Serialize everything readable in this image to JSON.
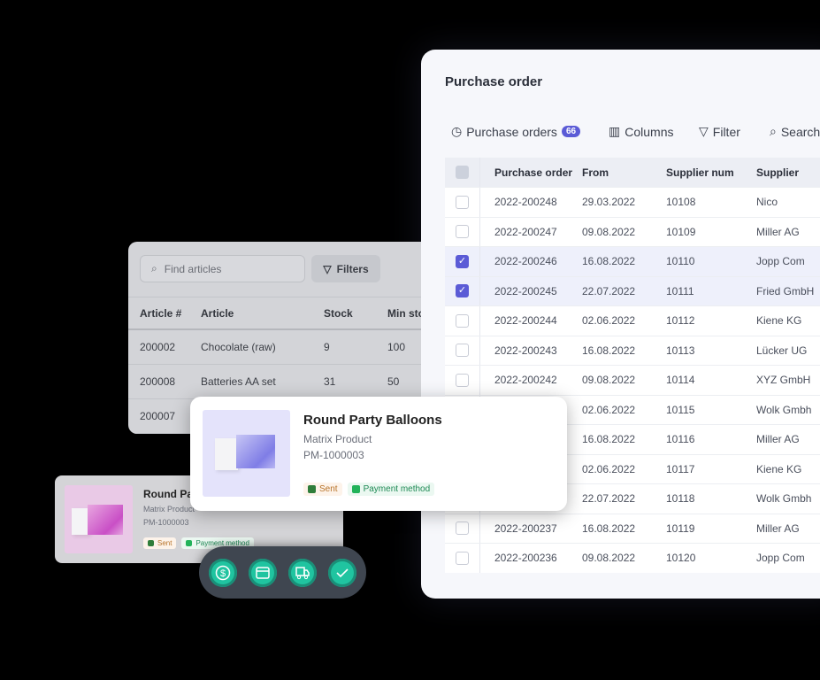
{
  "purchase_order": {
    "title": "Purchase order",
    "toolbar": {
      "orders_label": "Purchase orders",
      "orders_count": "66",
      "columns_label": "Columns",
      "filter_label": "Filter",
      "search_label": "Search"
    },
    "columns": [
      "Purchase order",
      "From",
      "Supplier num",
      "Supplier"
    ],
    "rows": [
      {
        "po": "2022-200248",
        "from": "29.03.2022",
        "num": "10108",
        "supplier": "Nico",
        "checked": false
      },
      {
        "po": "2022-200247",
        "from": "09.08.2022",
        "num": "10109",
        "supplier": "Miller AG",
        "checked": false
      },
      {
        "po": "2022-200246",
        "from": "16.08.2022",
        "num": "10110",
        "supplier": "Jopp Com",
        "checked": true
      },
      {
        "po": "2022-200245",
        "from": "22.07.2022",
        "num": "10111",
        "supplier": "Fried GmbH",
        "checked": true
      },
      {
        "po": "2022-200244",
        "from": "02.06.2022",
        "num": "10112",
        "supplier": "Kiene KG",
        "checked": false
      },
      {
        "po": "2022-200243",
        "from": "16.08.2022",
        "num": "10113",
        "supplier": "Lücker UG",
        "checked": false
      },
      {
        "po": "2022-200242",
        "from": "09.08.2022",
        "num": "10114",
        "supplier": "XYZ GmbH",
        "checked": false
      },
      {
        "po": "",
        "from": "02.06.2022",
        "num": "10115",
        "supplier": "Wolk Gmbh",
        "checked": false
      },
      {
        "po": "",
        "from": "16.08.2022",
        "num": "10116",
        "supplier": "Miller AG",
        "checked": false
      },
      {
        "po": "",
        "from": "02.06.2022",
        "num": "10117",
        "supplier": "Kiene KG",
        "checked": false
      },
      {
        "po": "",
        "from": "22.07.2022",
        "num": "10118",
        "supplier": "Wolk Gmbh",
        "checked": false
      },
      {
        "po": "2022-200237",
        "from": "16.08.2022",
        "num": "10119",
        "supplier": "Miller AG",
        "checked": false
      },
      {
        "po": "2022-200236",
        "from": "09.08.2022",
        "num": "10120",
        "supplier": "Jopp Com",
        "checked": false
      }
    ]
  },
  "articles": {
    "search_placeholder": "Find articles",
    "filters_label": "Filters",
    "columns": [
      "Article #",
      "Article",
      "Stock",
      "Min stock"
    ],
    "rows": [
      [
        "200002",
        "Chocolate (raw)",
        "9",
        "100"
      ],
      [
        "200008",
        "Batteries AA set",
        "31",
        "50"
      ],
      [
        "200007",
        "",
        "",
        ""
      ]
    ]
  },
  "product_card": {
    "title": "Round Party Balloons",
    "type": "Matrix Product",
    "sku": "PM-1000003",
    "tags": [
      "Sent",
      "Payment method"
    ]
  },
  "back_card": {
    "title": "Round Pa",
    "type": "Matrix Product",
    "sku": "PM-1000003",
    "tags": [
      "Sent",
      "Payment method"
    ]
  },
  "actions": [
    "dollar-icon",
    "calendar-icon",
    "truck-icon",
    "check-icon"
  ],
  "colors": {
    "accent": "#5b5bd6",
    "action": "#20c4a0"
  }
}
